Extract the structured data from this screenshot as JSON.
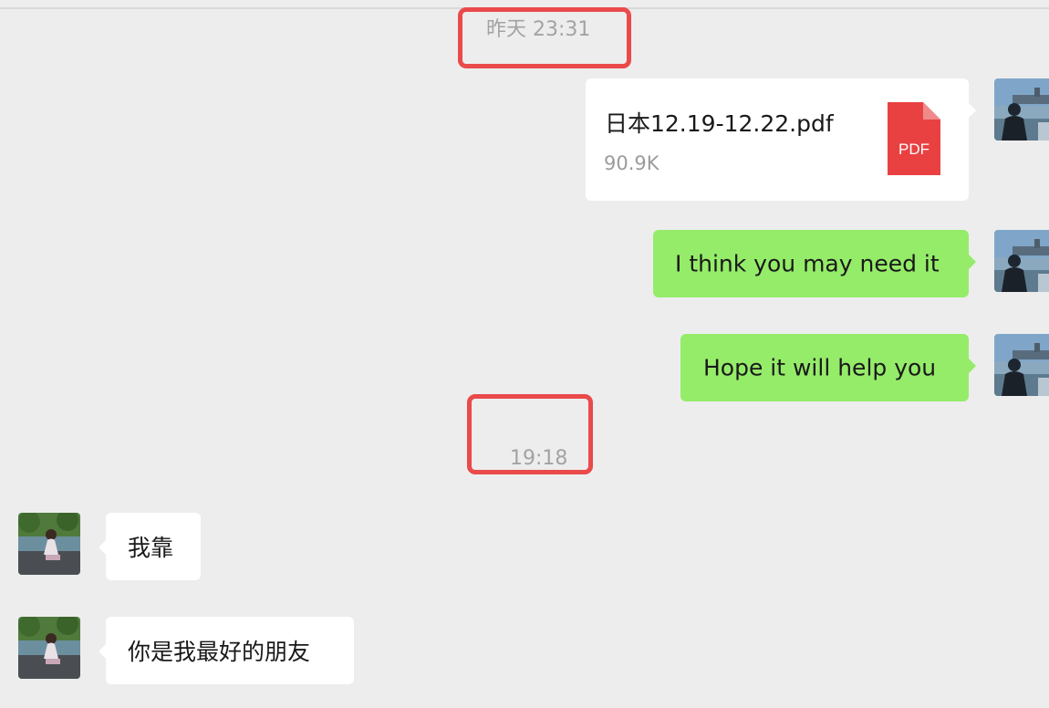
{
  "chat": {
    "timestamps": [
      "昨天 23:31",
      "19:18"
    ],
    "messages": [
      {
        "sender": "self",
        "type": "file",
        "file_name": "日本12.19-12.22.pdf",
        "file_size": "90.9K",
        "file_icon_label": "PDF",
        "icon": "pdf-file-icon"
      },
      {
        "sender": "self",
        "type": "text",
        "text": "I think you may need it"
      },
      {
        "sender": "self",
        "type": "text",
        "text": "Hope it will help you"
      },
      {
        "sender": "friend",
        "type": "text",
        "text": "我靠"
      },
      {
        "sender": "friend",
        "type": "text",
        "text": "你是我最好的朋友"
      }
    ]
  },
  "colors": {
    "background": "#ededed",
    "outgoing_bubble": "#95ec69",
    "incoming_bubble": "#ffffff",
    "timestamp_text": "#a3a3a3",
    "annotation_box": "#ea4a4a",
    "pdf_icon": "#e94141"
  }
}
